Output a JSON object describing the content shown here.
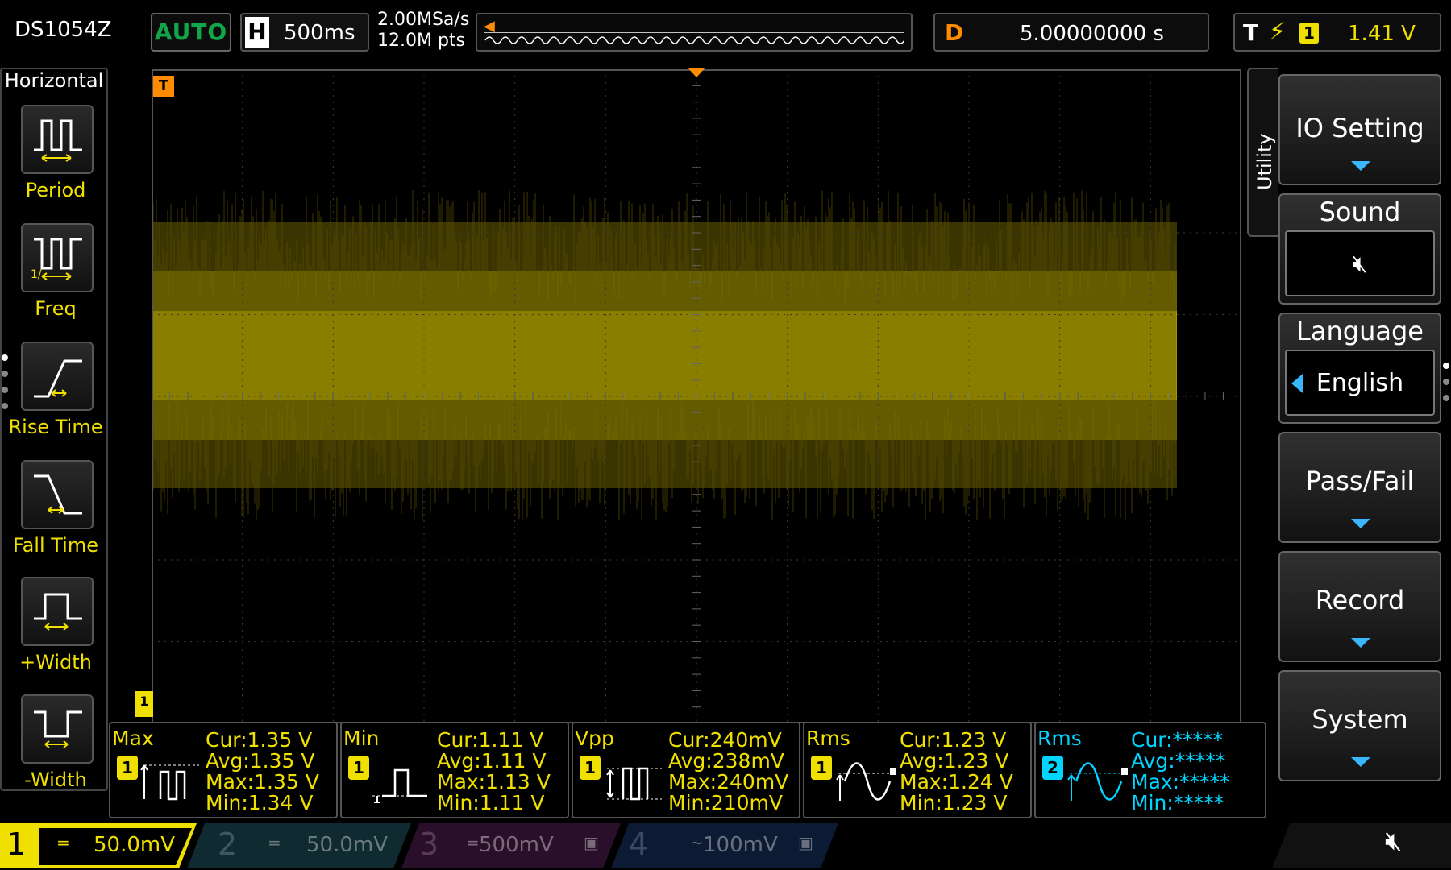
{
  "top": {
    "model": "DS1054Z",
    "run_mode": "AUTO",
    "horizontal_label": "H",
    "timebase": "500ms",
    "sample_rate": "2.00MSa/s",
    "memory_depth": "12.0M pts",
    "delay_label": "D",
    "delay_value": "5.00000000 s",
    "trigger_label": "T",
    "trigger_channel": "1",
    "trigger_level": "1.41 V"
  },
  "left_panel": {
    "title": "Horizontal",
    "items": [
      {
        "label": "Period",
        "icon": "period-icon"
      },
      {
        "label": "Freq",
        "icon": "freq-icon"
      },
      {
        "label": "Rise Time",
        "icon": "rise-time-icon"
      },
      {
        "label": "Fall Time",
        "icon": "fall-time-icon"
      },
      {
        "label": "+Width",
        "icon": "positive-width-icon"
      },
      {
        "label": "-Width",
        "icon": "negative-width-icon"
      }
    ]
  },
  "markers": {
    "trigger_marker": "T",
    "channel_marker": "1"
  },
  "right_menu": {
    "tab_label": "Utility",
    "io_setting": "IO Setting",
    "sound": "Sound",
    "sound_icon": "speaker-muted-icon",
    "language": "Language",
    "language_value": "English",
    "pass_fail": "Pass/Fail",
    "record": "Record",
    "system": "System"
  },
  "measurements": [
    {
      "name": "Max",
      "channel": "1",
      "cur": "Cur:1.35 V",
      "avg": "Avg:1.35 V",
      "max": "Max:1.35 V",
      "min": "Min:1.34 V"
    },
    {
      "name": "Min",
      "channel": "1",
      "cur": "Cur:1.11 V",
      "avg": "Avg:1.11 V",
      "max": "Max:1.13 V",
      "min": "Min:1.11 V"
    },
    {
      "name": "Vpp",
      "channel": "1",
      "cur": "Cur:240mV",
      "avg": "Avg:238mV",
      "max": "Max:240mV",
      "min": "Min:210mV"
    },
    {
      "name": "Rms",
      "channel": "1",
      "cur": "Cur:1.23 V",
      "avg": "Avg:1.23 V",
      "max": "Max:1.24 V",
      "min": "Min:1.23 V"
    },
    {
      "name": "Rms",
      "channel": "2",
      "cur": "Cur:*****",
      "avg": "Avg:*****",
      "max": "Max:*****",
      "min": "Min:*****"
    }
  ],
  "channels": [
    {
      "num": "1",
      "coupling": "=",
      "scale": "50.0mV",
      "color": "#f0e000",
      "active": true
    },
    {
      "num": "2",
      "coupling": "=",
      "scale": "50.0mV",
      "color": "#00d4ff",
      "active": false
    },
    {
      "num": "3",
      "coupling": "=",
      "scale": "500mV",
      "color": "#e020e0",
      "active": false
    },
    {
      "num": "4",
      "coupling": "~",
      "scale": "100mV",
      "color": "#1a6aff",
      "active": false
    }
  ],
  "colors": {
    "ch1": "#f0e000",
    "ch2": "#00d4ff",
    "trigger": "#ff8c00",
    "menu_arrow": "#3ab6ff",
    "auto": "#11a64a"
  }
}
